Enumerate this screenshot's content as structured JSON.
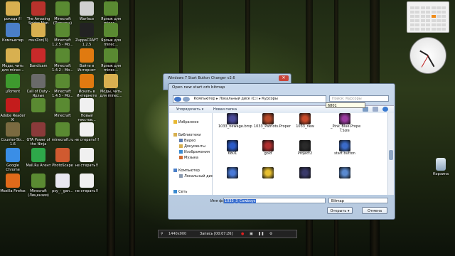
{
  "desktop_icons": [
    {
      "label": "рокада)!!",
      "icon": "folder-icon",
      "color": "#d8b050"
    },
    {
      "label": "The Amazing Spider-Man",
      "icon": "spiderman-icon",
      "color": "#b8322c"
    },
    {
      "label": "Minecraft (Пиратка)",
      "icon": "minecraft-icon",
      "color": "#5a8a32"
    },
    {
      "label": "Warface",
      "icon": "warface-icon",
      "color": "#d0d0d0"
    },
    {
      "label": "Ярлык для minec...",
      "icon": "minecraft-icon",
      "color": "#5a8a32"
    },
    {
      "label": "Компьютер",
      "icon": "computer-icon",
      "color": "#4a7fc8"
    },
    {
      "label": "muzZon(3)",
      "icon": "folder-icon",
      "color": "#d8b050"
    },
    {
      "label": "Minecraft 1.2.5 - Mo...",
      "icon": "minecraft-icon",
      "color": "#5a8a32"
    },
    {
      "label": "ZuppaCRAFT 1.2.5",
      "icon": "zuppacraft-icon",
      "color": "#222222"
    },
    {
      "label": "Ярлык для minec...",
      "icon": "minecraft-icon",
      "color": "#5a8a32"
    },
    {
      "label": "Моды, чить для minec...",
      "icon": "folder-icon",
      "color": "#d8b050"
    },
    {
      "label": "Bandicam",
      "icon": "bandicam-icon",
      "color": "#c82a2a"
    },
    {
      "label": "Minecraft 1.4.2 - Mo...",
      "icon": "minecraft-icon",
      "color": "#5a8a32"
    },
    {
      "label": "Войти в Интернет",
      "icon": "internet-icon",
      "color": "#e07a10"
    },
    {
      "label": "Ярлык для minec...",
      "icon": "minecraft-icon",
      "color": "#5a8a32"
    },
    {
      "label": "µTorrent",
      "icon": "utorrent-icon",
      "color": "#3e9a2e"
    },
    {
      "label": "Call of Duty - Ярлык",
      "icon": "cod-icon",
      "color": "#6a6a6a"
    },
    {
      "label": "Minecraft 1.4.5 - Mo...",
      "icon": "minecraft-icon",
      "color": "#5a8a32"
    },
    {
      "label": "Искать в Интернете",
      "icon": "search-web-icon",
      "color": "#e07a10"
    },
    {
      "label": "Моды, чить для minec...",
      "icon": "folder-icon",
      "color": "#d8b050"
    },
    {
      "label": "Adobe Reader XI",
      "icon": "adobe-reader-icon",
      "color": "#c41c1c"
    },
    {
      "label": "",
      "icon": "minecraft-icon",
      "color": "#5a8a32"
    },
    {
      "label": "Minecraft",
      "icon": "minecraft-icon",
      "color": "#5a8a32"
    },
    {
      "label": "Новый текстов...",
      "icon": "text-file-icon",
      "color": "#f0f0f0"
    },
    {
      "label": "",
      "icon": "",
      "color": ""
    },
    {
      "label": "Counter-Str... 1.6",
      "icon": "counter-strike-icon",
      "color": "#7a6a40"
    },
    {
      "label": "GTA Power of the Ninja",
      "icon": "gta-icon",
      "color": "#8a3a3a"
    },
    {
      "label": "minecraft.ru",
      "icon": "minecraft-icon",
      "color": "#5a8a32"
    },
    {
      "label": "не стерать!!!",
      "icon": "text-file-icon",
      "color": "#f0f0f0"
    },
    {
      "label": "",
      "icon": "",
      "color": ""
    },
    {
      "label": "Google Chrome",
      "icon": "chrome-icon",
      "color": "#3a8ee6"
    },
    {
      "label": "Mail.Ru Агент",
      "icon": "mailru-agent-icon",
      "color": "#2ea84a"
    },
    {
      "label": "PhotoScape",
      "icon": "photoscape-icon",
      "color": "#d05a30"
    },
    {
      "label": "не стерать!!",
      "icon": "text-file-icon",
      "color": "#f0f0f0"
    },
    {
      "label": "",
      "icon": "",
      "color": ""
    },
    {
      "label": "Mozilla Firefox",
      "icon": "firefox-icon",
      "color": "#e06a1a"
    },
    {
      "label": "Minecraft (Лицензия)",
      "icon": "minecraft-icon",
      "color": "#5a8a32"
    },
    {
      "label": "psy_-_gan...",
      "icon": "audio-file-icon",
      "color": "#e8e8f0"
    },
    {
      "label": "не стерать!!",
      "icon": "text-file-icon",
      "color": "#f0f0f0"
    }
  ],
  "recycle_bin": {
    "label": "Корзина",
    "icon": "recycle-bin-icon"
  },
  "calendar": {
    "highlight_color": "#f08c1a"
  },
  "clock": {
    "icon": "clock-icon"
  },
  "outer_window": {
    "title": "Windows 7 Start Button Changer v2.6",
    "close": "✕"
  },
  "dialog": {
    "title": "Open new start orb bitmap",
    "address": "Компьютер ▸ Локальный диск (C:) ▸ Курсоры",
    "search_placeholder": "Поиск: Курсоры",
    "toolbar": {
      "organize": "Упорядочить ▾",
      "new_folder": "Новая папка"
    },
    "nav": [
      {
        "label": "Избранное",
        "icon": "favorites-icon",
        "color": "#e8b830"
      },
      {
        "label": "Библиотеки",
        "icon": "libraries-icon",
        "color": "#d8b050"
      },
      {
        "label": "Видео",
        "icon": "video-icon",
        "color": "#5a7ab0"
      },
      {
        "label": "Документы",
        "icon": "documents-icon",
        "color": "#d8b050"
      },
      {
        "label": "Изображения",
        "icon": "images-icon",
        "color": "#3a8ad0"
      },
      {
        "label": "Музыка",
        "icon": "music-icon",
        "color": "#d06a30"
      },
      {
        "label": "Компьютер",
        "icon": "computer-icon",
        "color": "#4a7fc8"
      },
      {
        "label": "Локальный диск",
        "icon": "drive-icon",
        "color": "#8a9ab0"
      },
      {
        "label": "Сеть",
        "icon": "network-icon",
        "color": "#3a8ad0"
      }
    ],
    "files": [
      {
        "label": "1033_newage.bmp",
        "color": "#4a4a9a"
      },
      {
        "label": "1033_Patriots.Proper",
        "color": "#b84a2a"
      },
      {
        "label": "1033_new",
        "color": "#c84a2a"
      },
      {
        "label": "_Pink_Blue.Prope r.Size",
        "color": "#9a3aa0"
      },
      {
        "label": "6801",
        "color": "#2a5ac8"
      },
      {
        "label": "gold",
        "color": "#b03030"
      },
      {
        "label": "Project2",
        "color": "#2a2a2a"
      },
      {
        "label": "start button",
        "color": "#3a6ac8"
      },
      {
        "label": "",
        "color": "#4a7ad8"
      },
      {
        "label": "",
        "color": "#e8c030"
      },
      {
        "label": "",
        "color": "#3a3a6a"
      },
      {
        "label": "",
        "color": "#5a8ad0"
      }
    ],
    "tooltip": "6801",
    "filename_label": "Имя файла:",
    "filename_value": "1033_3_Cowboys",
    "filetype": "Bitmap",
    "open_button": "Открыть ▾",
    "cancel_button": "Отмена"
  },
  "recording_bar": {
    "resolution": "1440x900",
    "status": "Запись [00:07:26]"
  }
}
